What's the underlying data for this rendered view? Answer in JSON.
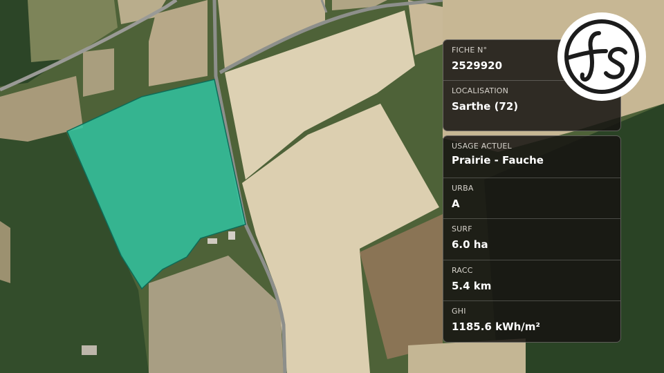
{
  "map": {
    "colors": {
      "parcel_fill": "#2fc7a3",
      "parcel_stroke": "#0e6b57",
      "forest": "#2f4a2a",
      "dry_field": "#d9cba8",
      "road": "#9a9a96"
    }
  },
  "logo": {
    "icon": "fs-logo-icon",
    "color": "#1c1c1c"
  },
  "parcel_card": {
    "fiche_label": "FICHE N°",
    "fiche_value": "2529920",
    "localisation_label": "LOCALISATION",
    "localisation_value": "Sarthe (72)"
  },
  "details_card": {
    "usage_label": "USAGE ACTUEL",
    "usage_value": "Prairie - Fauche",
    "urba_label": "URBA",
    "urba_value": "A",
    "surf_label": "SURF",
    "surf_value": "6.0 ha",
    "racc_label": "RACC",
    "racc_value": "5.4 km",
    "ghi_label": "GHI",
    "ghi_value": "1185.6 kWh/m²"
  }
}
